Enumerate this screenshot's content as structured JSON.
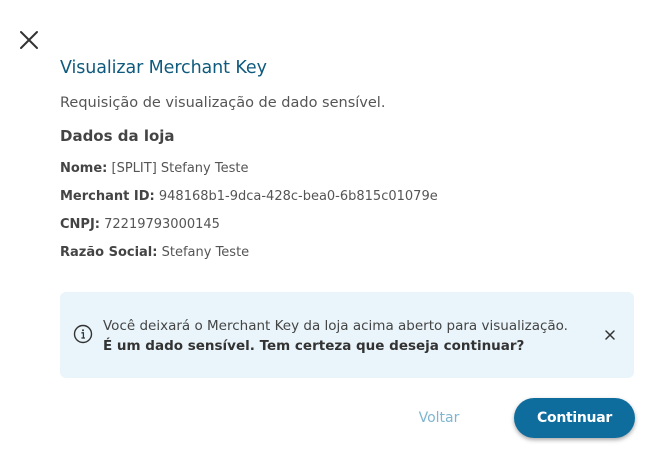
{
  "dialog": {
    "title": "Visualizar Merchant Key",
    "subtitle": "Requisição de visualização de dado sensível.",
    "section_title": "Dados da loja",
    "close_icon": "close-icon"
  },
  "store": {
    "name_label": "Nome:",
    "name_value": "[SPLIT] Stefany Teste",
    "merchant_id_label": "Merchant ID:",
    "merchant_id_value": "948168b1-9dca-428c-bea0-6b815c01079e",
    "cnpj_label": "CNPJ:",
    "cnpj_value": "72219793000145",
    "razao_label": "Razão Social:",
    "razao_value": "Stefany Teste"
  },
  "alert": {
    "icon": "info-icon",
    "line1": "Você deixará o Merchant Key da loja acima aberto para visualização.",
    "line2": "É um dado sensível. Tem certeza que deseja continuar?",
    "close_icon": "close-icon",
    "background": "#e9f5fb"
  },
  "actions": {
    "back_label": "Voltar",
    "continue_label": "Continuar"
  },
  "colors": {
    "title": "#0f5a7d",
    "primary": "#0f6d9e",
    "link": "#7fb6cf"
  }
}
